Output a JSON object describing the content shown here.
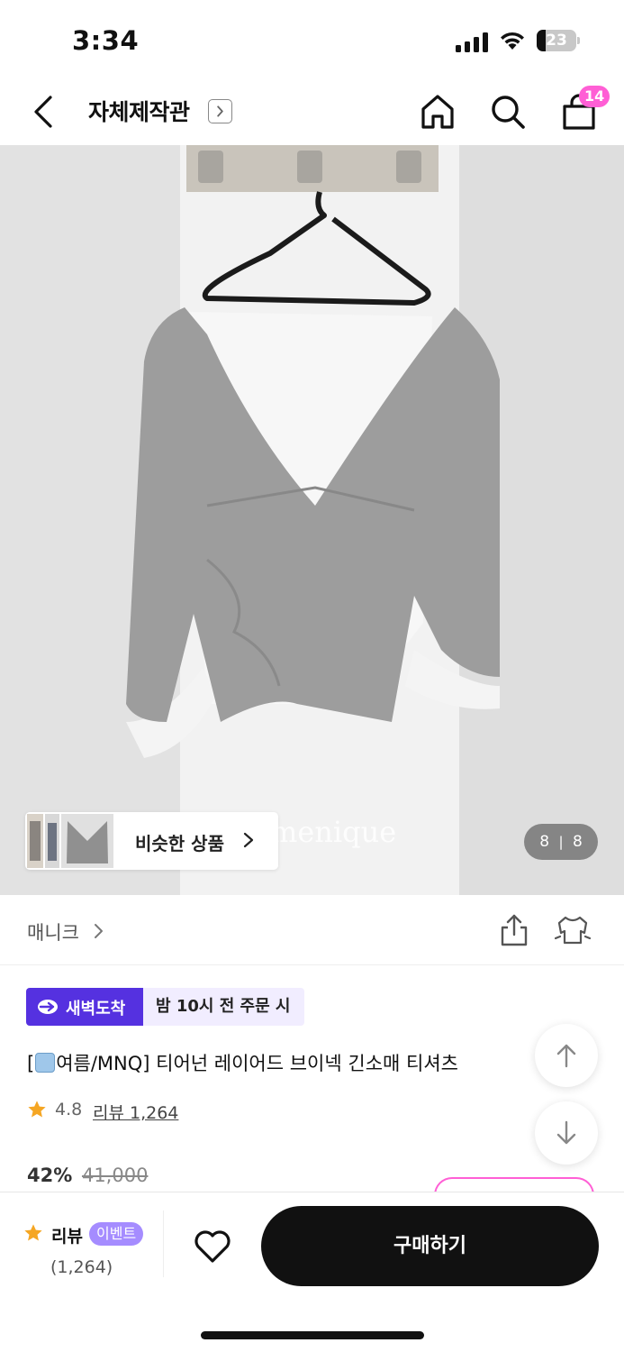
{
  "status_bar": {
    "time": "3:34",
    "battery": "23",
    "battery_level": 0.23
  },
  "nav": {
    "shop_title": "자체제작관",
    "cart_count": "14"
  },
  "product_image": {
    "watermark": "menique",
    "similar_label": "비슷한 상품",
    "counter_current": "8",
    "counter_sep": "|",
    "counter_total": "8"
  },
  "brand": {
    "name": "매니크"
  },
  "delivery": {
    "badge": "새벽도착",
    "note": "밤 10시 전 주문 시"
  },
  "product": {
    "title_prefix": "[",
    "title_text": "여름/MNQ] 티어넌 레이어드 브이넥 긴소매 티셔츠",
    "rating": "4.8",
    "review_label": "리뷰 1,264",
    "discount": "42%",
    "original_price": "41,000"
  },
  "bottom_bar": {
    "review_label": "리뷰",
    "event_label": "이벤트",
    "review_count": "(1,264)",
    "buy_label": "구매하기"
  },
  "colors": {
    "accent_pink": "#ff5fd5",
    "delivery_purple": "#5531e0",
    "event_purple": "#a58cff",
    "star_orange": "#f5a623"
  }
}
